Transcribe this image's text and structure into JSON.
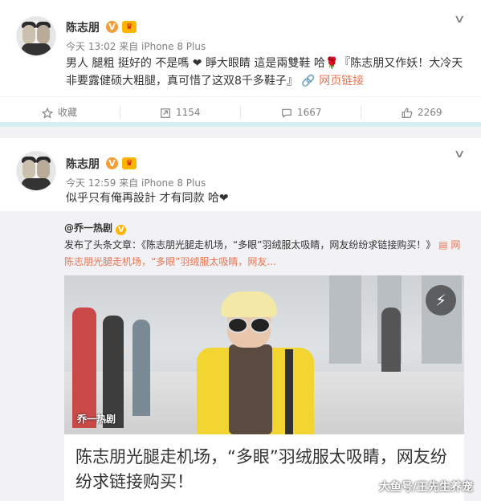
{
  "post1": {
    "username": "陈志朋",
    "meta": "今天 13:02 来自 iPhone 8 Plus",
    "text_line1": "男人 腿粗 挺好的 不是嗎 ❤ 睜大眼睛 這是兩雙鞋 哈🌹『陈志朋又作妖！大冷天",
    "text_line2": "非要露健硕大粗腿，真可惜了这双8千多鞋子』",
    "link_text": "网页链接",
    "actions": {
      "favorite": "收藏",
      "repost": "1154",
      "comment": "1667",
      "like": "2269"
    }
  },
  "post2": {
    "username": "陈志朋",
    "meta": "今天 12:59 来自 iPhone 8 Plus",
    "text": "似乎只有俺再設計 才有同款 哈❤",
    "repost": {
      "author": "@乔一热剧",
      "line1": "发布了头条文章：《陈志朋光腿走机场，“多眼”羽绒服太吸睛，网友纷纷求链接购买！》",
      "line1_link": "网",
      "line2": "陈志朋光腿走机场，“多眼”羽绒服太吸睛，网友...",
      "photo_watermark": "乔一热剧",
      "headline": "陈志朋光腿走机场，“多眼”羽绒服太吸睛，网友纷纷求链接购买！"
    }
  },
  "watermark": "大鱼号/王先生养宠",
  "colors": {
    "link": "#eb7350",
    "badge": "#f29d38",
    "divider": "#d4eef2"
  }
}
